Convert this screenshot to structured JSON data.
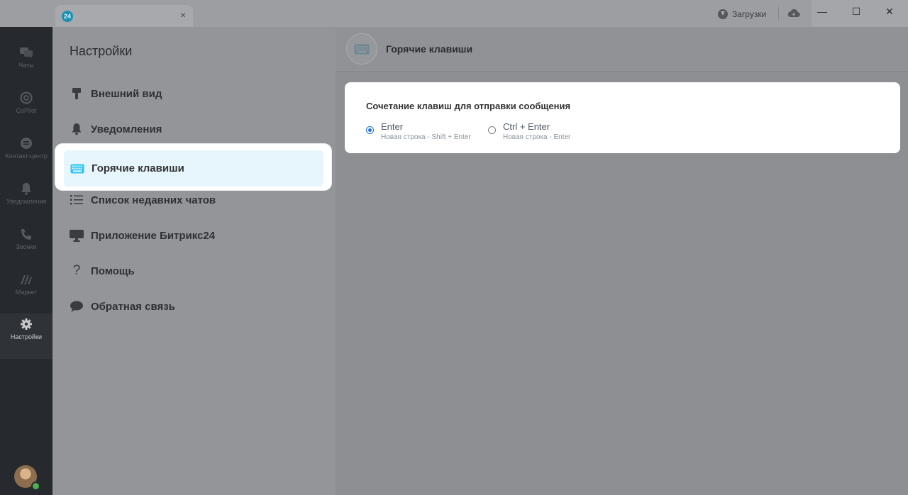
{
  "titlebar": {
    "tab_logo": "24",
    "tab_title": "",
    "tab_close": "×",
    "downloads_label": "Загрузки",
    "minimize": "—",
    "maximize": "☐",
    "close": "✕"
  },
  "rail": {
    "items": [
      {
        "label": "Чаты",
        "icon": "chat-icon"
      },
      {
        "label": "CoPilot",
        "icon": "copilot-icon"
      },
      {
        "label": "Контакт-центр",
        "icon": "contact-center-icon"
      },
      {
        "label": "Уведомления",
        "icon": "bell-icon"
      },
      {
        "label": "Звонки",
        "icon": "phone-icon"
      },
      {
        "label": "Маркет",
        "icon": "market-icon"
      },
      {
        "label": "Настройки",
        "icon": "gear-icon",
        "active": true
      }
    ]
  },
  "settings": {
    "title": "Настройки",
    "menu": [
      {
        "label": "Внешний вид",
        "icon": "brush-icon"
      },
      {
        "label": "Уведомления",
        "icon": "bell-icon"
      },
      {
        "label": "Горячие клавиши",
        "icon": "keyboard-icon",
        "active": true
      },
      {
        "label": "Список недавних чатов",
        "icon": "list-icon"
      },
      {
        "label": "Приложение Битрикс24",
        "icon": "monitor-icon"
      },
      {
        "label": "Помощь",
        "icon": "help-icon"
      },
      {
        "label": "Обратная связь",
        "icon": "feedback-icon"
      }
    ]
  },
  "content": {
    "header_title": "Горячие клавиши",
    "card_title": "Сочетание клавиш для отправки сообщения",
    "options": [
      {
        "label": "Enter",
        "sub": "Новая строка - Shift + Enter",
        "checked": true
      },
      {
        "label": "Ctrl + Enter",
        "sub": "Новая строка - Enter",
        "checked": false
      }
    ]
  },
  "colors": {
    "accent": "#1f74e0",
    "highlight_bg": "#e7f6fd",
    "keyboard_icon": "#2fc6f6"
  }
}
